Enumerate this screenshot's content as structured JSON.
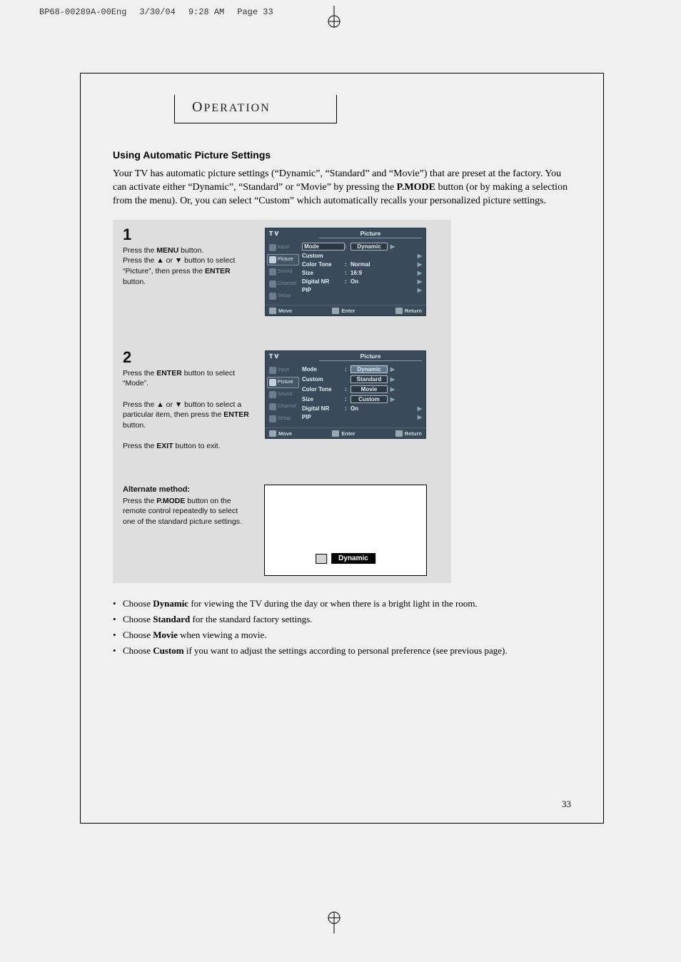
{
  "meta_strip": {
    "file": "BP68-00289A-00Eng",
    "date": "3/30/04",
    "time": "9:28 AM",
    "page_label": "Page 33"
  },
  "section_title": "Operation",
  "sub_heading": "Using Automatic Picture Settings",
  "intro": "Your TV has automatic picture settings (“Dynamic”, “Standard” and “Movie”) that are preset at the factory. You can activate either “Dynamic”, “Standard” or “Movie” by pressing the P.MODE button (or by making a selection from the menu). Or, you can select “Custom” which automatically recalls your personalized picture settings.",
  "intro_bold": "P.MODE",
  "step1": {
    "num": "1",
    "l1a": "Press the ",
    "l1b": "MENU",
    "l1c": " button.",
    "l2a": "Press the ",
    "l2b": "▲",
    "l2c": " or ",
    "l2d": "▼",
    "l2e": " button to select “Picture”, then press the ",
    "l2f": "ENTER",
    "l2g": " button."
  },
  "step2": {
    "num": "2",
    "l1a": "Press the ",
    "l1b": "ENTER",
    "l1c": " button to select “Mode”.",
    "l2a": "Press the ",
    "l2b": "▲",
    "l2c": " or ",
    "l2d": "▼",
    "l2e": " button to select a particular item, then press the ",
    "l2f": "ENTER",
    "l2g": " button.",
    "l3a": "Press the ",
    "l3b": "EXIT",
    "l3c": " button to exit."
  },
  "alt": {
    "heading": "Alternate method:",
    "l1a": "Press the ",
    "l1b": "P.MODE",
    "l1c": " button on the remote control repeatedly to select one of the standard picture settings."
  },
  "osd": {
    "tv": "T V",
    "panel_title": "Picture",
    "nav": {
      "input": "Input",
      "picture": "Picture",
      "sound": "Sound",
      "channel": "Channel",
      "setup": "Setup"
    },
    "rows": {
      "mode": "Mode",
      "custom": "Custom",
      "color_tone": "Color Tone",
      "size": "Size",
      "digital_nr": "Digital NR",
      "pip": "PIP"
    },
    "vals1": {
      "mode": "Dynamic",
      "color_tone": "Normal",
      "size": "16:9",
      "digital_nr": "On"
    },
    "vals2": {
      "mode_opts": [
        "Dynamic",
        "Standard",
        "Movie",
        "Custom"
      ],
      "digital_nr": "On"
    },
    "footer": {
      "move": "Move",
      "enter": "Enter",
      "return": "Return"
    }
  },
  "dynamic_label": "Dynamic",
  "bullets": [
    {
      "pre": "Choose ",
      "bold": "Dynamic",
      "post": " for viewing the TV during the day or when there is a bright light in the room."
    },
    {
      "pre": "Choose ",
      "bold": "Standard",
      "post": " for the standard factory settings."
    },
    {
      "pre": "Choose ",
      "bold": "Movie",
      "post": " when viewing a movie."
    },
    {
      "pre": "Choose ",
      "bold": "Custom",
      "post": " if you want to adjust the settings according to personal preference (see previous page)."
    }
  ],
  "page_num": "33"
}
